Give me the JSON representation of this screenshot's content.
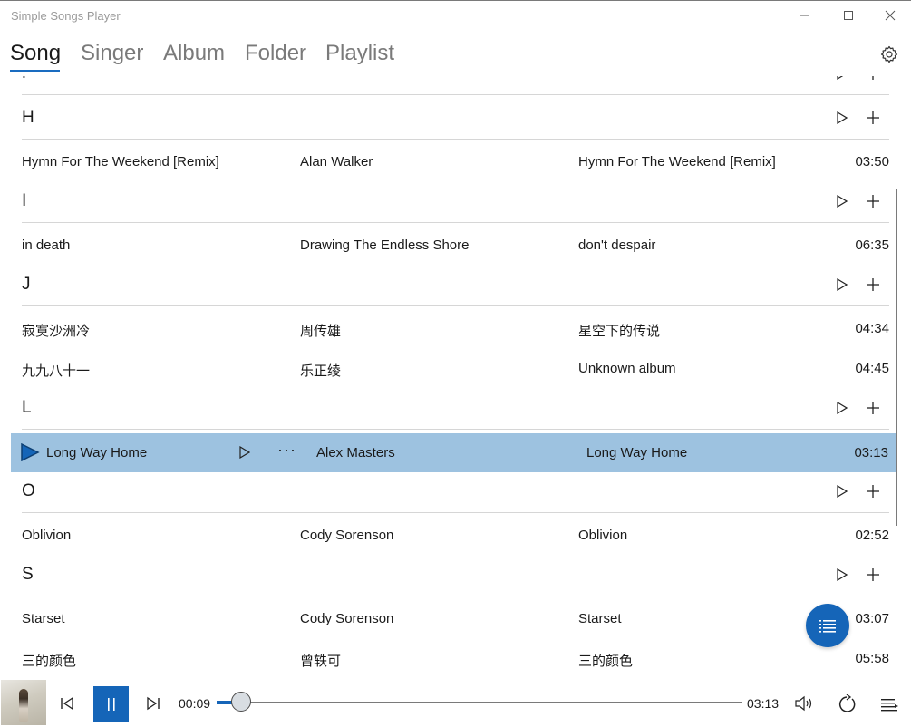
{
  "app": {
    "title": "Simple Songs Player"
  },
  "window_controls": {
    "minimize": "minimize-icon",
    "maximize": "maximize-icon",
    "close": "close-icon"
  },
  "nav": {
    "tabs": [
      {
        "label": "Song",
        "active": true
      },
      {
        "label": "Singer",
        "active": false
      },
      {
        "label": "Album",
        "active": false
      },
      {
        "label": "Folder",
        "active": false
      },
      {
        "label": "Playlist",
        "active": false
      }
    ],
    "settings_icon": "gear-icon"
  },
  "groups": [
    {
      "letter": "F"
    },
    {
      "letter": "H"
    },
    {
      "letter": "I"
    },
    {
      "letter": "J"
    },
    {
      "letter": "L"
    },
    {
      "letter": "O"
    },
    {
      "letter": "S"
    }
  ],
  "songs": [
    {
      "title": "Hymn For The Weekend [Remix]",
      "artist": "Alan Walker",
      "album": "Hymn For The Weekend [Remix]",
      "duration": "03:50"
    },
    {
      "title": "in death",
      "artist": "Drawing The Endless Shore",
      "album": "don't despair",
      "duration": "06:35"
    },
    {
      "title": "寂寞沙洲冷",
      "artist": "周传雄",
      "album": "星空下的传说",
      "duration": "04:34"
    },
    {
      "title": "九九八十一",
      "artist": "乐正绫",
      "album": "Unknown album",
      "duration": "04:45"
    },
    {
      "title": "Long Way Home",
      "artist": "Alex Masters",
      "album": "Long Way Home",
      "duration": "03:13",
      "now_playing": true
    },
    {
      "title": "Oblivion",
      "artist": "Cody Sorenson",
      "album": "Oblivion",
      "duration": "02:52"
    },
    {
      "title": "Starset",
      "artist": "Cody Sorenson",
      "album": "Starset",
      "duration": "03:07"
    },
    {
      "title": "三的颜色",
      "artist": "曾轶可",
      "album": "三的颜色",
      "duration": "05:58"
    }
  ],
  "now_playing_row": {
    "more_label": "···"
  },
  "player": {
    "elapsed": "00:09",
    "total": "03:13",
    "progress_fraction": 0.047,
    "accent": "#1565b8",
    "icons": {
      "prev": "skip-previous-icon",
      "pause": "pause-icon",
      "next": "skip-next-icon",
      "volume": "volume-icon",
      "repeat": "repeat-icon",
      "queue": "queue-list-icon",
      "fab": "playlist-icon"
    }
  },
  "colors": {
    "highlight": "#9dc2e0",
    "accent": "#1565b8",
    "divider": "#d6d6d6"
  }
}
